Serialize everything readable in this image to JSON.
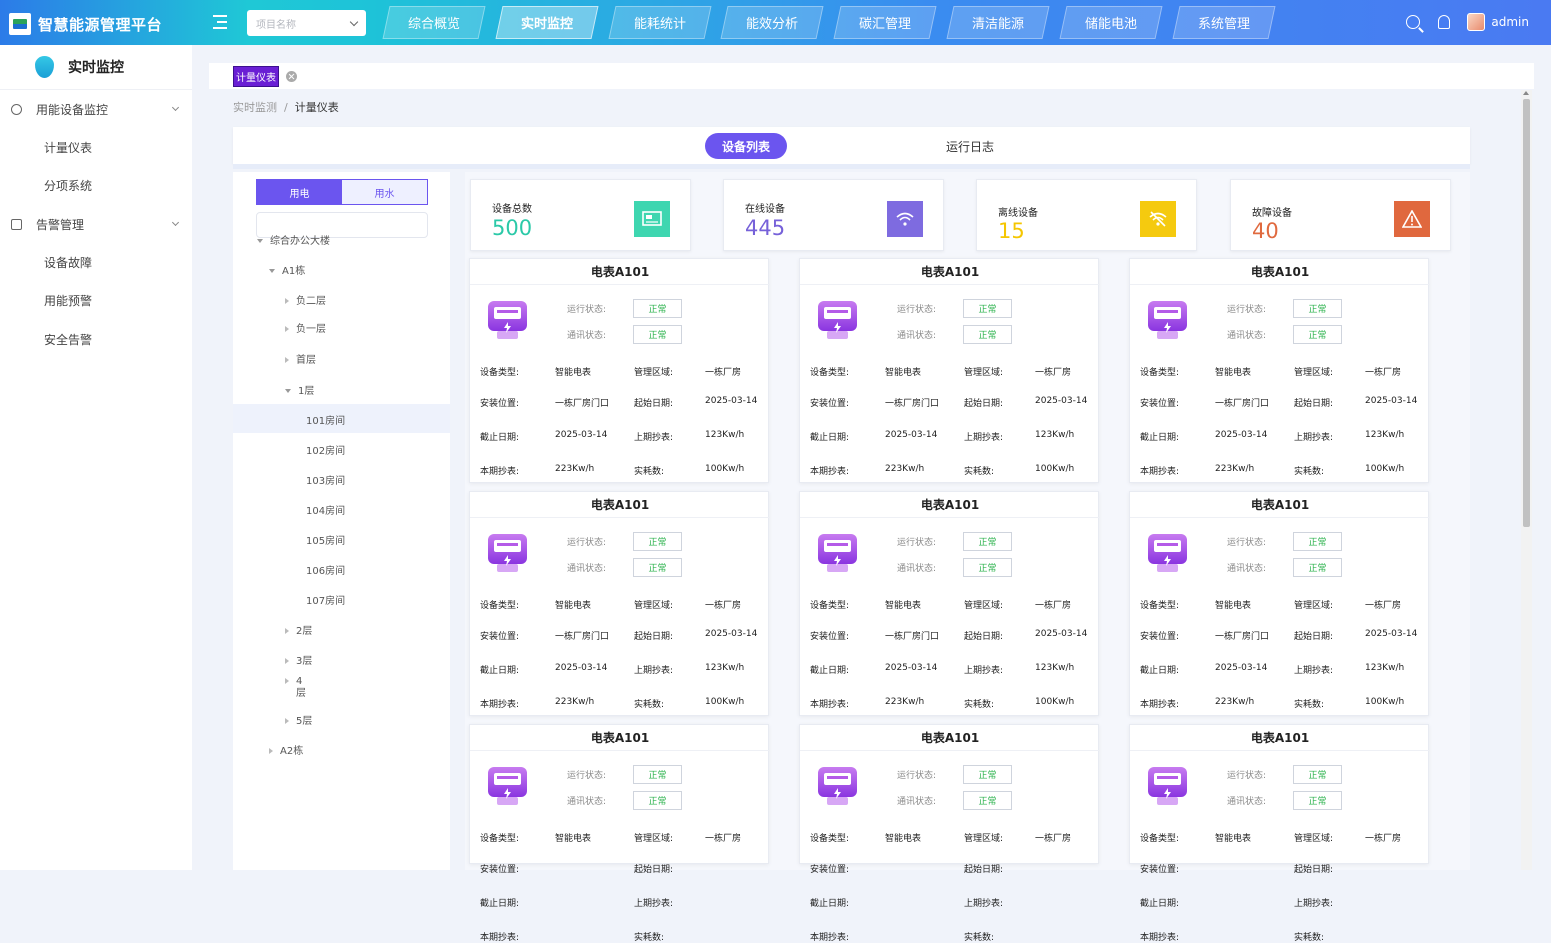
{
  "app": {
    "title": "智慧能源管理平台"
  },
  "header": {
    "project_select": {
      "placeholder": "项目名称"
    },
    "tabs": [
      {
        "label": "综合概览",
        "active": false
      },
      {
        "label": "实时监控",
        "active": true
      },
      {
        "label": "能耗统计",
        "active": false
      },
      {
        "label": "能效分析",
        "active": false
      },
      {
        "label": "碳汇管理",
        "active": false
      },
      {
        "label": "清洁能源",
        "active": false
      },
      {
        "label": "储能电池",
        "active": false
      },
      {
        "label": "系统管理",
        "active": false
      }
    ],
    "user": "admin"
  },
  "sidebar": {
    "section_title": "实时监控",
    "groups": [
      {
        "label": "用能设备监控",
        "items": [
          "计量仪表",
          "分项系统"
        ]
      },
      {
        "label": "告警管理",
        "items": [
          "设备故障",
          "用能预警",
          "安全告警"
        ]
      }
    ]
  },
  "tag": {
    "label": "计量仪表"
  },
  "breadcrumb": {
    "parent": "实时监测",
    "separator": "/",
    "current": "计量仪表"
  },
  "view_tabs": {
    "active": "设备列表",
    "other": "运行日志"
  },
  "tree": {
    "toggle": {
      "active": "用电",
      "other": "用水"
    },
    "nodes": [
      {
        "label": "综合办公大楼",
        "level": 0,
        "expanded": true
      },
      {
        "label": "A1栋",
        "level": 1,
        "expanded": true
      },
      {
        "label": "负二层",
        "level": 2,
        "expanded": false
      },
      {
        "label": "负一层",
        "level": 2,
        "expanded": false
      },
      {
        "label": "首层",
        "level": 2,
        "expanded": false
      },
      {
        "label": "1层",
        "level": 2,
        "expanded": true
      },
      {
        "label": "101房间",
        "level": 3,
        "selected": true
      },
      {
        "label": "102房间",
        "level": 3
      },
      {
        "label": "103房间",
        "level": 3
      },
      {
        "label": "104房间",
        "level": 3
      },
      {
        "label": "105房间",
        "level": 3
      },
      {
        "label": "106房间",
        "level": 3
      },
      {
        "label": "107房间",
        "level": 3
      },
      {
        "label": "2层",
        "level": 2,
        "expanded": false
      },
      {
        "label": "3层",
        "level": 2,
        "expanded": false
      },
      {
        "label": "4层",
        "level": 2,
        "expanded": false,
        "wrapped": true
      },
      {
        "label": "5层",
        "level": 2,
        "expanded": false
      },
      {
        "label": "A2栋",
        "level": 1,
        "expanded": false
      }
    ]
  },
  "stats": [
    {
      "label": "设备总数",
      "value": "500",
      "color": "#2bc9a8",
      "icon": "monitor-icon",
      "icon_bg": "#3ed6b0"
    },
    {
      "label": "在线设备",
      "value": "445",
      "color": "#7661d9",
      "icon": "wifi-icon",
      "icon_bg": "#7e6be0"
    },
    {
      "label": "离线设备",
      "value": "15",
      "color": "#f5c600",
      "icon": "wifi-off-icon",
      "icon_bg": "#f5ca0f"
    },
    {
      "label": "故障设备",
      "value": "40",
      "color": "#e06a3f",
      "icon": "warning-icon",
      "icon_bg": "#e0683e"
    }
  ],
  "card_labels": {
    "run_status": "运行状态:",
    "comm_status": "通讯状态:",
    "device_type": "设备类型:",
    "mgmt_area": "管理区域:",
    "install_loc": "安装位置:",
    "start_date": "起始日期:",
    "end_date": "截止日期:",
    "last_reading": "上期抄表:",
    "this_reading": "本期抄表:",
    "consumption": "实耗数:"
  },
  "cards": [
    {
      "name": "电表A101",
      "run_status": "正常",
      "comm_status": "正常",
      "device_type": "智能电表",
      "mgmt_area": "一栋厂房",
      "install_loc": "一栋厂房门口",
      "start_date": "2025-03-14",
      "end_date": "2025-03-14",
      "last_reading": "123Kw/h",
      "this_reading": "223Kw/h",
      "consumption": "100Kw/h"
    },
    {
      "name": "电表A101",
      "run_status": "正常",
      "comm_status": "正常",
      "device_type": "智能电表",
      "mgmt_area": "一栋厂房",
      "install_loc": "一栋厂房门口",
      "start_date": "2025-03-14",
      "end_date": "2025-03-14",
      "last_reading": "123Kw/h",
      "this_reading": "223Kw/h",
      "consumption": "100Kw/h"
    },
    {
      "name": "电表A101",
      "run_status": "正常",
      "comm_status": "正常",
      "device_type": "智能电表",
      "mgmt_area": "一栋厂房",
      "install_loc": "一栋厂房门口",
      "start_date": "2025-03-14",
      "end_date": "2025-03-14",
      "last_reading": "123Kw/h",
      "this_reading": "223Kw/h",
      "consumption": "100Kw/h"
    },
    {
      "name": "电表A101",
      "run_status": "正常",
      "comm_status": "正常",
      "device_type": "智能电表",
      "mgmt_area": "一栋厂房",
      "install_loc": "一栋厂房门口",
      "start_date": "2025-03-14",
      "end_date": "2025-03-14",
      "last_reading": "123Kw/h",
      "this_reading": "223Kw/h",
      "consumption": "100Kw/h"
    },
    {
      "name": "电表A101",
      "run_status": "正常",
      "comm_status": "正常",
      "device_type": "智能电表",
      "mgmt_area": "一栋厂房",
      "install_loc": "一栋厂房门口",
      "start_date": "2025-03-14",
      "end_date": "2025-03-14",
      "last_reading": "123Kw/h",
      "this_reading": "223Kw/h",
      "consumption": "100Kw/h"
    },
    {
      "name": "电表A101",
      "run_status": "正常",
      "comm_status": "正常",
      "device_type": "智能电表",
      "mgmt_area": "一栋厂房",
      "install_loc": "一栋厂房门口",
      "start_date": "2025-03-14",
      "end_date": "2025-03-14",
      "last_reading": "123Kw/h",
      "this_reading": "223Kw/h",
      "consumption": "100Kw/h"
    },
    {
      "name": "电表A101",
      "run_status": "正常",
      "comm_status": "正常",
      "device_type": "智能电表",
      "mgmt_area": "一栋厂房",
      "install_loc": "",
      "start_date": "",
      "end_date": "",
      "last_reading": "",
      "this_reading": "",
      "consumption": ""
    },
    {
      "name": "电表A101",
      "run_status": "正常",
      "comm_status": "正常",
      "device_type": "智能电表",
      "mgmt_area": "一栋厂房",
      "install_loc": "",
      "start_date": "",
      "end_date": "",
      "last_reading": "",
      "this_reading": "",
      "consumption": ""
    },
    {
      "name": "电表A101",
      "run_status": "正常",
      "comm_status": "正常",
      "device_type": "智能电表",
      "mgmt_area": "一栋厂房",
      "install_loc": "",
      "start_date": "",
      "end_date": "",
      "last_reading": "",
      "this_reading": "",
      "consumption": ""
    }
  ]
}
